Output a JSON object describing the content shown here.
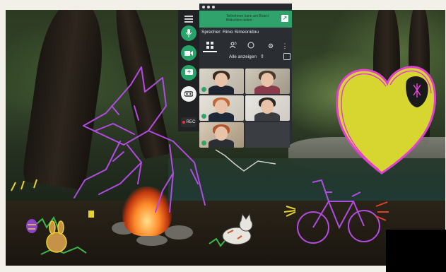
{
  "banner": {
    "text": "Teilnehmer kann am Board Bildschirm teilen"
  },
  "meeting": {
    "speaker_label": "Sprecher: Rinio Simeonidou",
    "participants_count": "5",
    "show_all_label": "Alle anzeigen",
    "rec_label": "REC"
  },
  "rail": {
    "items": [
      "menu-icon",
      "microphone-icon",
      "camera-icon",
      "share-screen-icon",
      "vr-headset-icon"
    ]
  },
  "tabs": [
    "grid-view-icon",
    "participants-icon",
    "chat-icon",
    "settings-icon",
    "more-icon"
  ],
  "colors": {
    "accent": "#2fa36b",
    "panel": "#2a2d31",
    "scribble": "#b04ce0",
    "heart_fill": "#d7d631"
  }
}
